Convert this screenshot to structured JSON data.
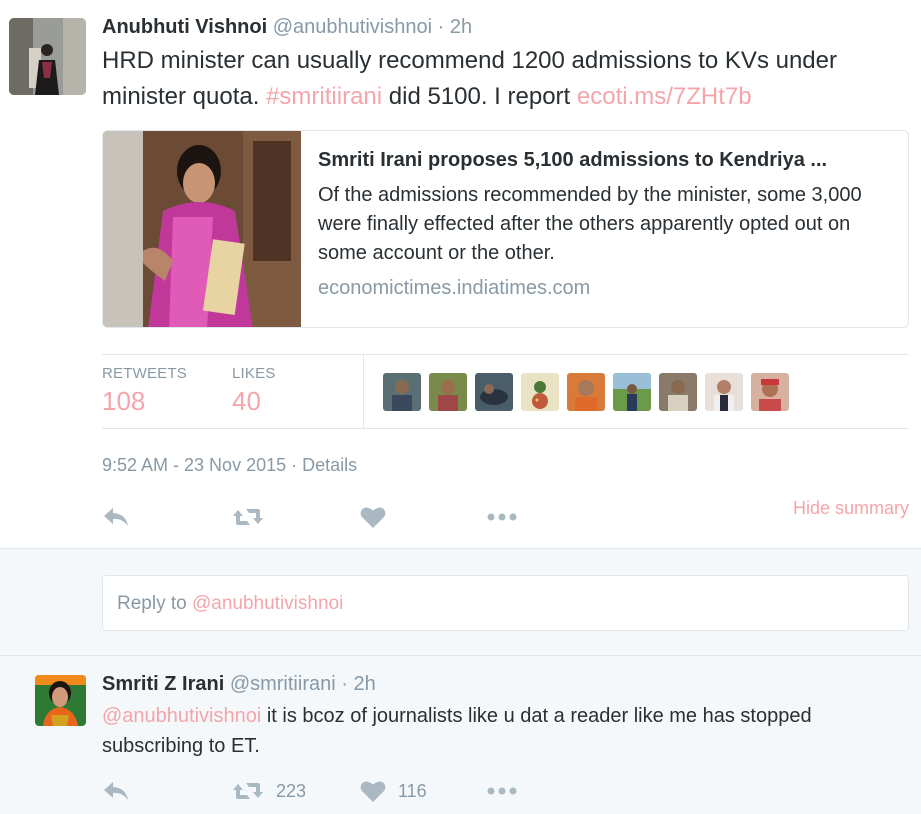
{
  "tweet": {
    "author_name": "Anubhuti Vishnoi",
    "author_handle": "@anubhutivishnoi",
    "dot": "·",
    "time": "2h",
    "text_1": "HRD minister can usually recommend 1200 admissions to KVs under minister quota. ",
    "hashtag": "#smritiirani",
    "text_2": " did 5100. I report ",
    "link": "ecoti.ms/7ZHt7b",
    "card": {
      "title": "Smriti Irani proposes 5,100 admissions to Kendriya ...",
      "description": "Of the admissions recommended by the minister, some 3,000 were finally effected after the others apparently opted out on some account or the other.",
      "domain": "economictimes.indiatimes.com"
    },
    "stats": {
      "retweets_label": "RETWEETS",
      "retweets_count": "108",
      "likes_label": "LIKES",
      "likes_count": "40"
    },
    "liker_avatars": [
      "liker-avatar-1",
      "liker-avatar-2",
      "liker-avatar-3",
      "liker-avatar-4",
      "liker-avatar-5",
      "liker-avatar-6",
      "liker-avatar-7",
      "liker-avatar-8",
      "liker-avatar-9"
    ],
    "timestamp": "9:52 AM - 23 Nov 2015",
    "details_sep": " · ",
    "details": "Details",
    "hide_summary": "Hide summary"
  },
  "reply_box": {
    "prefix": "Reply to ",
    "mention": "@anubhutivishnoi"
  },
  "reply": {
    "author_name": "Smriti Z Irani",
    "author_handle": "@smritiirani",
    "dot": "·",
    "time": "2h",
    "mention": "@anubhutivishnoi",
    "text": " it is bcoz of journalists like u dat a reader like me has stopped subscribing to ET.",
    "retweet_count": "223",
    "like_count": "116"
  },
  "icons": [
    "reply-icon",
    "retweet-icon",
    "heart-icon",
    "more-icon"
  ],
  "colors": {
    "accent": "#f4a5ab",
    "muted": "#8899a6",
    "icon": "#aab8c2",
    "border": "#e1e8ed",
    "bg_alt": "#f5f8fa"
  }
}
